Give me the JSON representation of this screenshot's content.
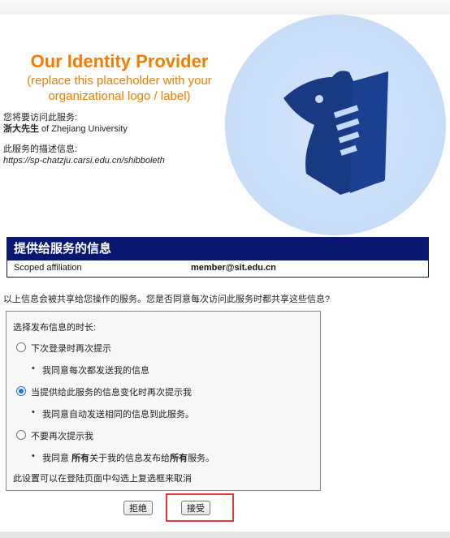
{
  "branding": {
    "title": "Our Identity Provider",
    "subtitle_line1": "(replace this placeholder with your",
    "subtitle_line2": "organizational logo / label)"
  },
  "service": {
    "access_label": "您将要访问此服务:",
    "name_bold": "浙大先生",
    "name_suffix": " of Zhejiang University",
    "description_label": "此服务的描述信息:",
    "url": "https://sp-chatzju.carsi.edu.cn/shibboleth"
  },
  "attributes": {
    "title": "提供给服务的信息",
    "rows": [
      {
        "name": "Scoped affiliation",
        "value": "member@sit.edu.cn"
      }
    ]
  },
  "consent_question": "以上信息会被共享给您操作的服务。您是否同意每次访问此服务时都共享这些信息?",
  "release_options": {
    "heading": "选择发布信息的时长:",
    "options": [
      {
        "label": "下次登录时再次提示",
        "detail": "我同意每次都发送我的信息",
        "selected": false
      },
      {
        "label": "当提供给此服务的信息变化时再次提示我",
        "detail": "我同意自动发送相同的信息到此服务。",
        "selected": true
      },
      {
        "label": "不要再次提示我",
        "detail_prefix": "我同意 ",
        "detail_bold1": "所有",
        "detail_mid": "关于我的信息发布给",
        "detail_bold2": "所有",
        "detail_suffix": "服务。",
        "selected": false
      }
    ],
    "footer_note": "此设置可以在登陆页面中勾选上复选框来取消"
  },
  "buttons": {
    "reject": "拒绝",
    "accept": "接受"
  },
  "colors": {
    "brand_orange": "#f57c00",
    "header_navy": "#0a1770",
    "logo_bg": "#c2d9f7",
    "highlight_red": "#e53935"
  },
  "icons": {
    "logo": "bird-logo-icon"
  }
}
